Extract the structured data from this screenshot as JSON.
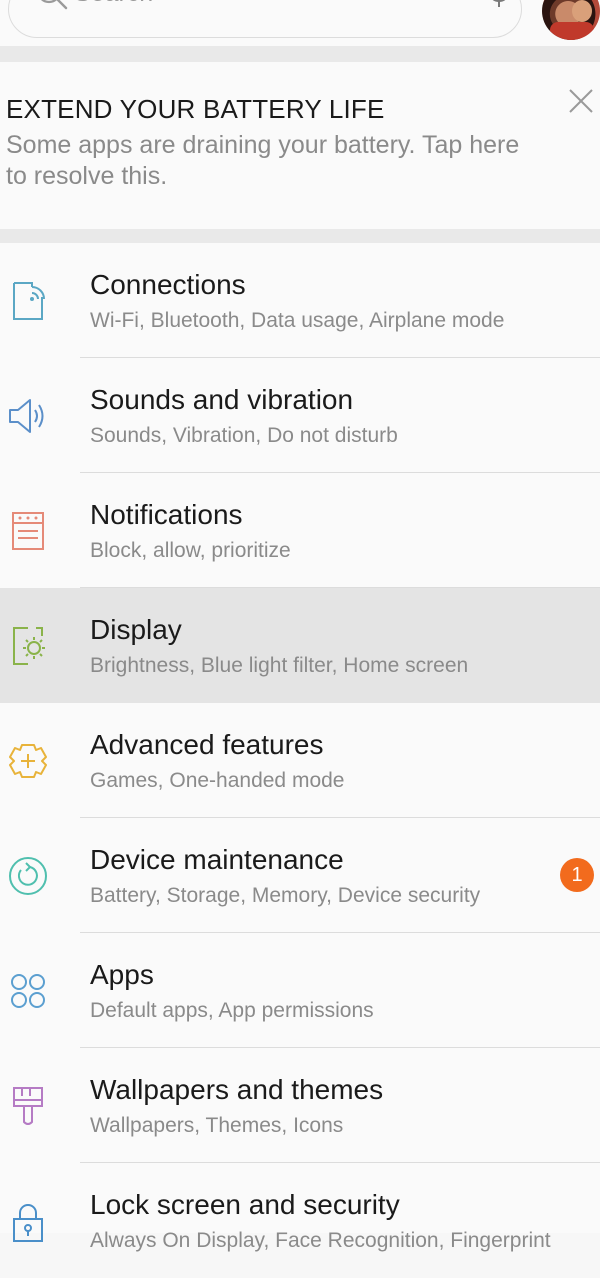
{
  "search": {
    "placeholder": "Search"
  },
  "battery_card": {
    "title": "EXTEND YOUR BATTERY LIFE",
    "description": "Some apps are draining your battery. Tap here to resolve this."
  },
  "colors": {
    "connections": "#5ba7c4",
    "sounds": "#5b8fc9",
    "notifications": "#e58a78",
    "display": "#8ab34a",
    "advanced": "#e8b33a",
    "maintenance": "#4fbfae",
    "apps": "#5b9fd0",
    "wallpapers": "#b57bc4",
    "lock": "#4a8fc9",
    "badge": "#f26b1d"
  },
  "settings": [
    {
      "title": "Connections",
      "subtitle": "Wi-Fi, Bluetooth, Data usage, Airplane mode",
      "icon": "connections-icon"
    },
    {
      "title": "Sounds and vibration",
      "subtitle": "Sounds, Vibration, Do not disturb",
      "icon": "speaker-icon"
    },
    {
      "title": "Notifications",
      "subtitle": "Block, allow, prioritize",
      "icon": "notifications-icon"
    },
    {
      "title": "Display",
      "subtitle": "Brightness, Blue light filter, Home screen",
      "icon": "display-icon"
    },
    {
      "title": "Advanced features",
      "subtitle": "Games, One-handed mode",
      "icon": "gear-plus-icon"
    },
    {
      "title": "Device maintenance",
      "subtitle": "Battery, Storage, Memory, Device security",
      "icon": "maintenance-icon",
      "badge": "1"
    },
    {
      "title": "Apps",
      "subtitle": "Default apps, App permissions",
      "icon": "apps-grid-icon"
    },
    {
      "title": "Wallpapers and themes",
      "subtitle": "Wallpapers, Themes, Icons",
      "icon": "paintbrush-icon"
    },
    {
      "title": "Lock screen and security",
      "subtitle": "Always On Display, Face Recognition, Fingerprint",
      "icon": "lock-icon"
    }
  ]
}
